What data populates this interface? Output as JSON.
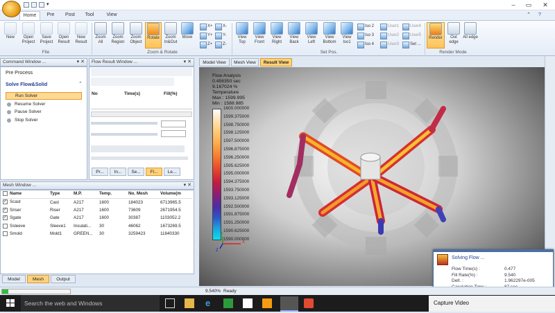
{
  "window": {
    "minimize": "–",
    "maximize": "▭",
    "close": "✕",
    "ribbon_min": "⌃",
    "help": "?"
  },
  "ribbon_tabs": [
    "Home",
    "Pre",
    "Post",
    "Tool",
    "View"
  ],
  "ribbon": {
    "file_buttons": [
      "New",
      "Open Project",
      "Save Project",
      "Open Result",
      "New Result"
    ],
    "zoom_buttons": [
      "Zoom All",
      "Zoom Region",
      "Zoom Object",
      "Rotate",
      "Zoom In&Out",
      "Move"
    ],
    "axis_buttons": [
      "X+",
      "Y+",
      "Z+",
      "X-",
      "Y-",
      "Z-"
    ],
    "view_buttons": [
      "View Top",
      "View Front",
      "View Right",
      "View Back",
      "View Left",
      "View Bottom",
      "View Iso1"
    ],
    "iso_buttons": [
      "Iso 2",
      "Iso 3",
      "Iso 4"
    ],
    "user_buttons": [
      "User1",
      "User2",
      "User3",
      "User4",
      "User5",
      "Set ..."
    ],
    "render_buttons": [
      "Render",
      "Out edge",
      "All edge"
    ],
    "groups": {
      "file": "File",
      "zoom": "Zoom & Rotate",
      "setpos": "Set Pos.",
      "render": "Render Mode"
    }
  },
  "command_window": {
    "title": "Command Window ...",
    "pre_process": "Pre Process",
    "solve_section": "Solve Flow&Solid",
    "items": [
      "Run Solver",
      "Resume Solver",
      "Pause Solver",
      "Stop Solver"
    ]
  },
  "flow_result": {
    "title": "Flow Result Window ...",
    "columns": [
      "No",
      "Time(s)",
      "Fill(%)"
    ],
    "tabs": [
      "Pr...",
      "In...",
      "Se...",
      "Fl...",
      "Le..."
    ]
  },
  "mesh_window": {
    "title": "Mesh Window ...",
    "columns": [
      "Name",
      "Type",
      "M.P.",
      "Temp.",
      "No. Mesh",
      "Volume(m"
    ],
    "rows": [
      {
        "checked": true,
        "name": "Scast",
        "type": "Cast",
        "mp": "A217",
        "temp": "1600",
        "mesh": "184023",
        "volume": "6713965.5"
      },
      {
        "checked": true,
        "name": "Sriser",
        "type": "Riser",
        "mp": "A217",
        "temp": "1600",
        "mesh": "73609",
        "volume": "2671954.5"
      },
      {
        "checked": true,
        "name": "Sgate",
        "type": "Gate",
        "mp": "A217",
        "temp": "1600",
        "mesh": "30387",
        "volume": "1103052.2"
      },
      {
        "checked": false,
        "name": "Ssleeve",
        "type": "Sleeve1",
        "mp": "Insulati...",
        "temp": "30",
        "mesh": "46062",
        "volume": "1673269.5"
      },
      {
        "checked": false,
        "name": "Smold",
        "type": "Mold1",
        "mp": "GREEN...",
        "temp": "30",
        "mesh": "3259423",
        "volume": "11840330"
      }
    ],
    "bottom_tabs": [
      "Model",
      "Mesh",
      "Output"
    ]
  },
  "view_tabs": [
    "Model View",
    "Mesh View",
    "Result View"
  ],
  "result": {
    "header": [
      "Flow Analysis",
      "0.456350 sec",
      "9.167024 %",
      "Temperature",
      "Max : 1599.995",
      "Min : 1588.985"
    ],
    "legend": [
      "1600.000000",
      "1599.375000",
      "1598.750000",
      "1598.125000",
      "1597.500000",
      "1596.875000",
      "1596.250000",
      "1595.625000",
      "1595.000000",
      "1594.375000",
      "1593.750000",
      "1593.125000",
      "1592.500000",
      "1591.875000",
      "1591.250000",
      "1590.625000",
      "1590.000000"
    ],
    "axes": {
      "x": "X",
      "y": "Y",
      "z": "Z"
    }
  },
  "solving": {
    "title": "Solving Flow ...",
    "rows": [
      {
        "label": "Flow Time(s) :",
        "value": "0.477"
      },
      {
        "label": "Fill Rate(%) :",
        "value": "9.540"
      },
      {
        "label": "Delt. :",
        "value": "1.962297e-005"
      },
      {
        "label": "Caculation Time :",
        "value": "87 sec"
      }
    ]
  },
  "status": {
    "percent": "9.540%",
    "state": "Ready",
    "progress": 0.095
  },
  "taskbar": {
    "search": "Search the web and Windows",
    "capture": "Capture Video"
  }
}
